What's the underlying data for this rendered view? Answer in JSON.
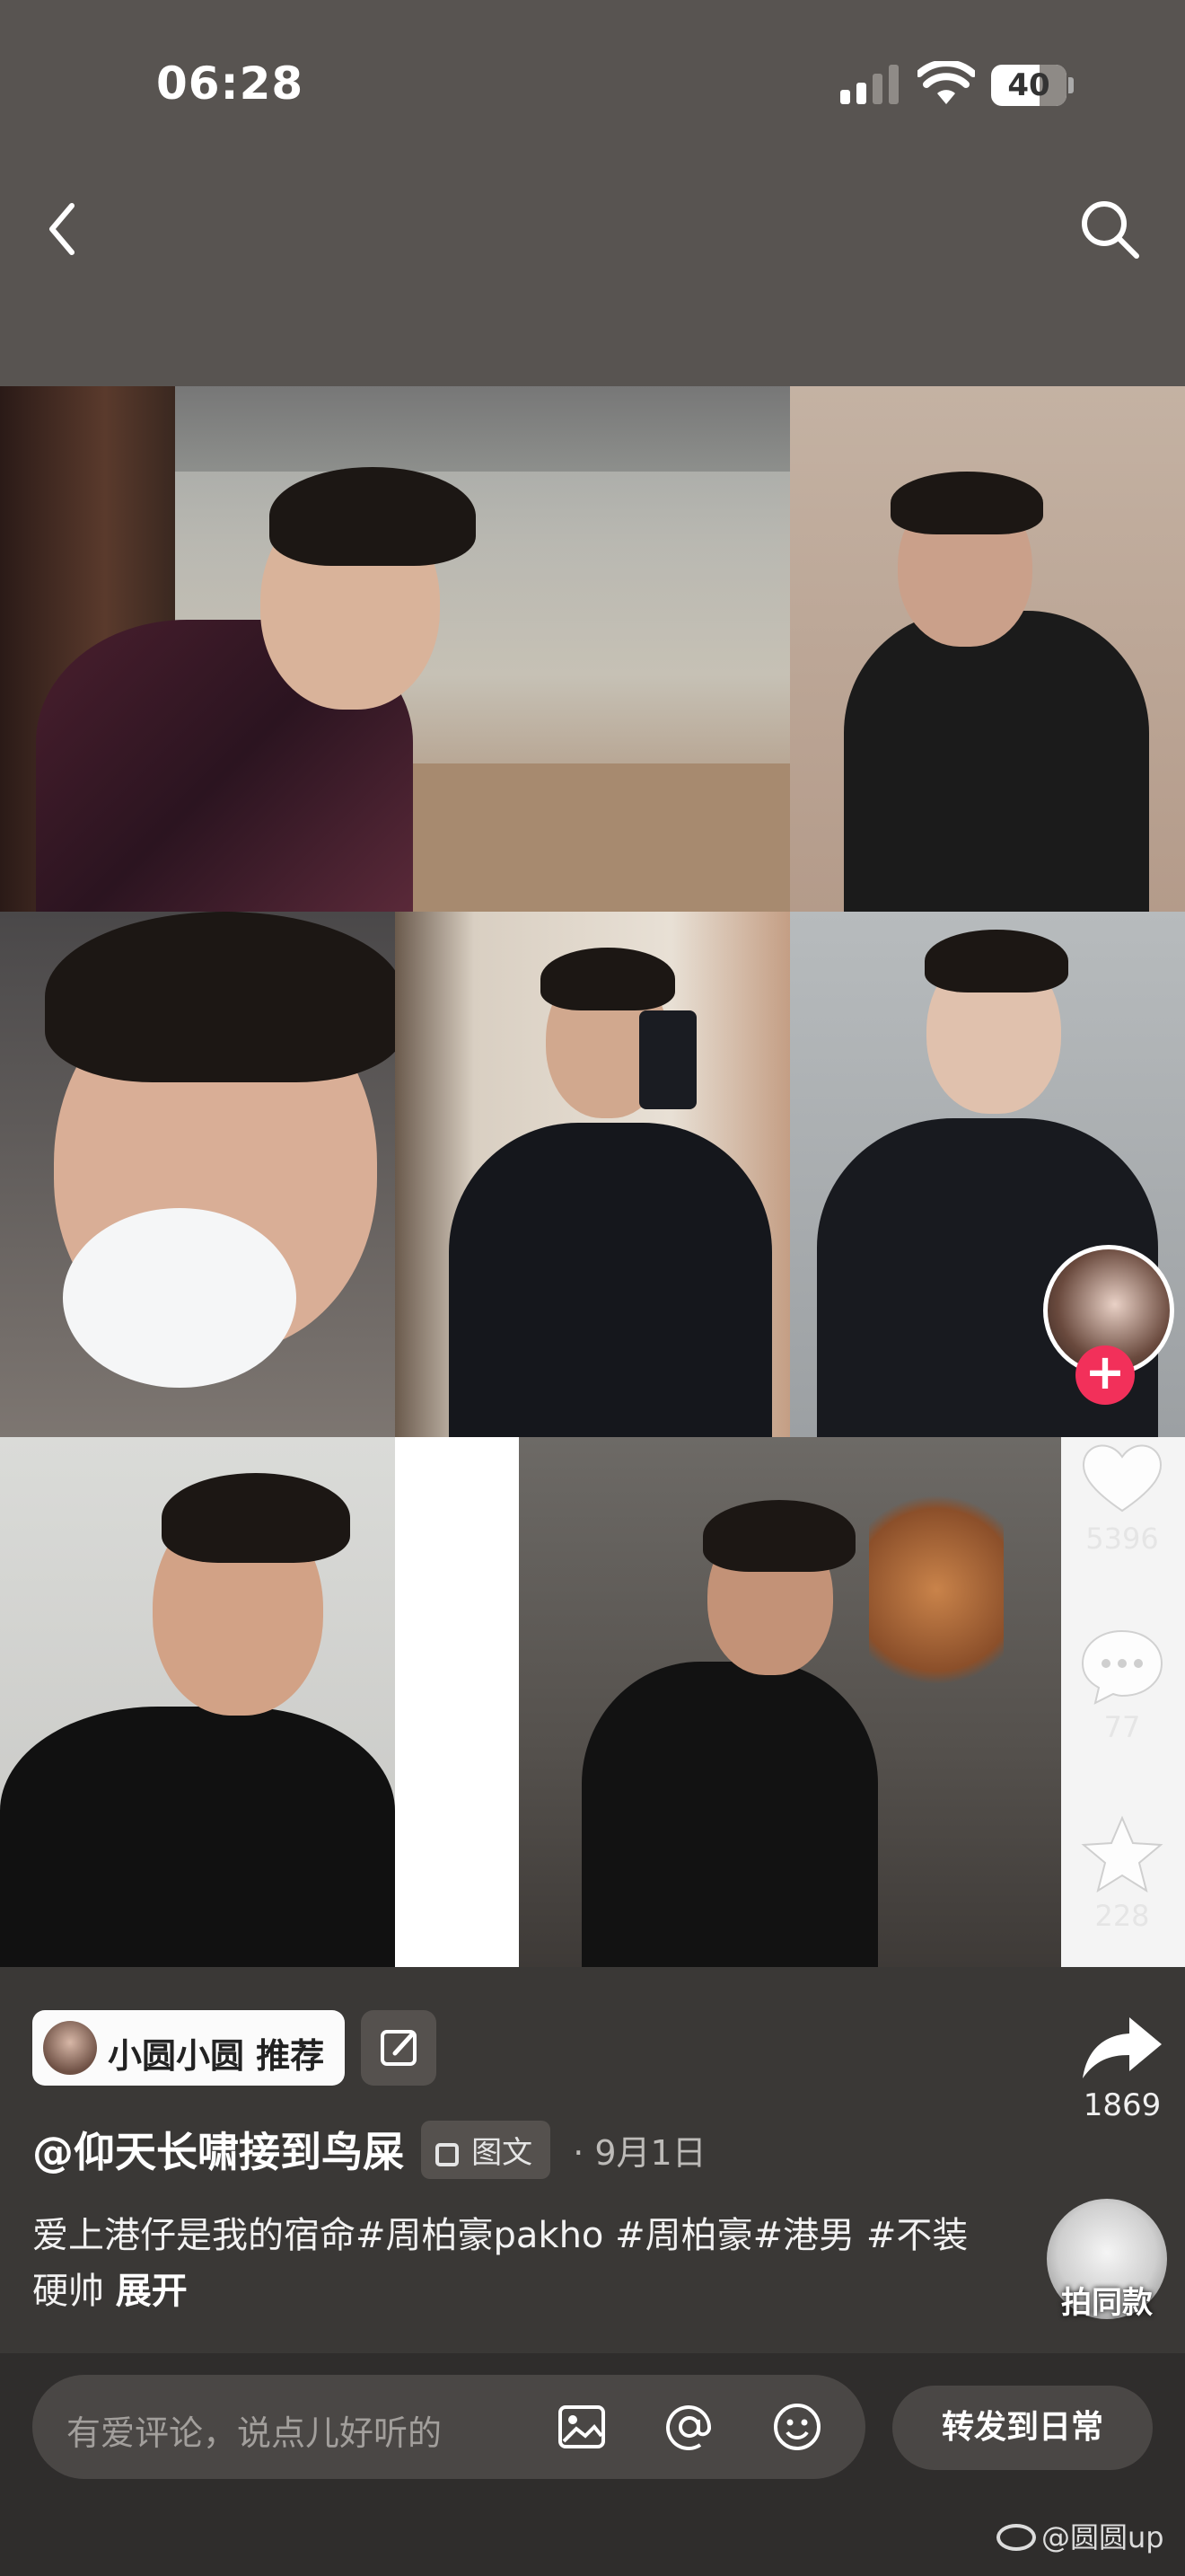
{
  "status_bar": {
    "time": "06:28",
    "battery": "40"
  },
  "nav": {
    "back_icon": "chevron-left-icon",
    "search_icon": "search-icon"
  },
  "side_actions": {
    "likes": "5396",
    "comments": "77",
    "favorites": "228",
    "shares": "1869"
  },
  "post": {
    "rec_chip": "小圆小圆 推荐",
    "author": "@仰天长啸接到鸟屎",
    "type_label": "图文",
    "date": "· 9月1日",
    "caption": "爱上港仔是我的宿命#周柏豪pakho #周柏豪#港男 #不装硬帅",
    "expand": "展开",
    "same_style": "拍同款"
  },
  "comment_bar": {
    "placeholder": "有爱评论，说点儿好听的",
    "forward": "转发到日常"
  },
  "watermark": "@圆圆up",
  "colors": {
    "accent": "#f2305a",
    "background": "#3a3836"
  }
}
